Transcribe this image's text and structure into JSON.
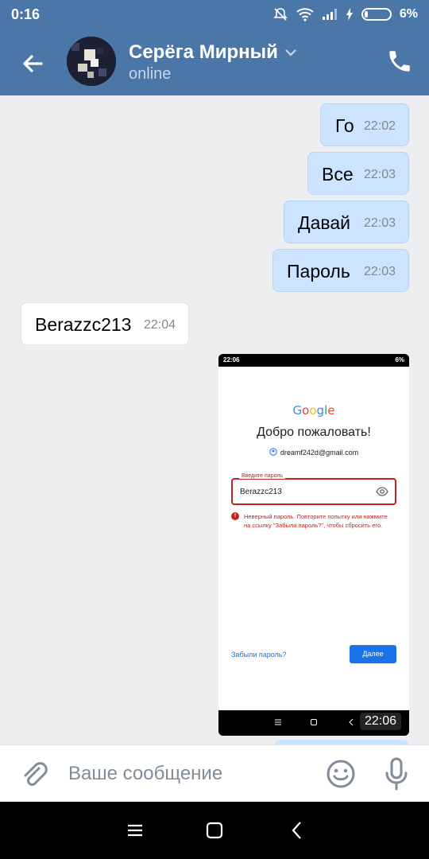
{
  "status_bar": {
    "time": "0:16",
    "battery": "6%"
  },
  "header": {
    "name": "Серёга Мирный",
    "status": "online"
  },
  "messages": [
    {
      "text": "Го",
      "time": "22:02",
      "direction": "out"
    },
    {
      "text": "Все",
      "time": "22:03",
      "direction": "out"
    },
    {
      "text": "Давай",
      "time": "22:03",
      "direction": "out"
    },
    {
      "text": "Пароль",
      "time": "22:03",
      "direction": "out"
    },
    {
      "text": "Berazzc213",
      "time": "22:04",
      "direction": "in"
    }
  ],
  "screenshot_message": {
    "time": "22:06",
    "status_time": "22:06",
    "status_battery": "6%",
    "logo": "Google",
    "title": "Добро пожаловать!",
    "email": "dreamf242d@gmail.com",
    "password_label": "Введите пароль",
    "password_value": "Berazzc213",
    "error": "Неверный пароль. Повторите попытку или нажмите на ссылку \"Забыли пароль?\", чтобы сбросить его.",
    "forgot_link": "Забыли пароль?",
    "next_button": "Далее"
  },
  "input": {
    "placeholder": "Ваше сообщение"
  },
  "colors": {
    "header": "#4a76a8",
    "bubble_out": "#cce4ff",
    "bubble_in": "#ffffff",
    "error": "#c5221f",
    "google_blue": "#1a73e8"
  }
}
